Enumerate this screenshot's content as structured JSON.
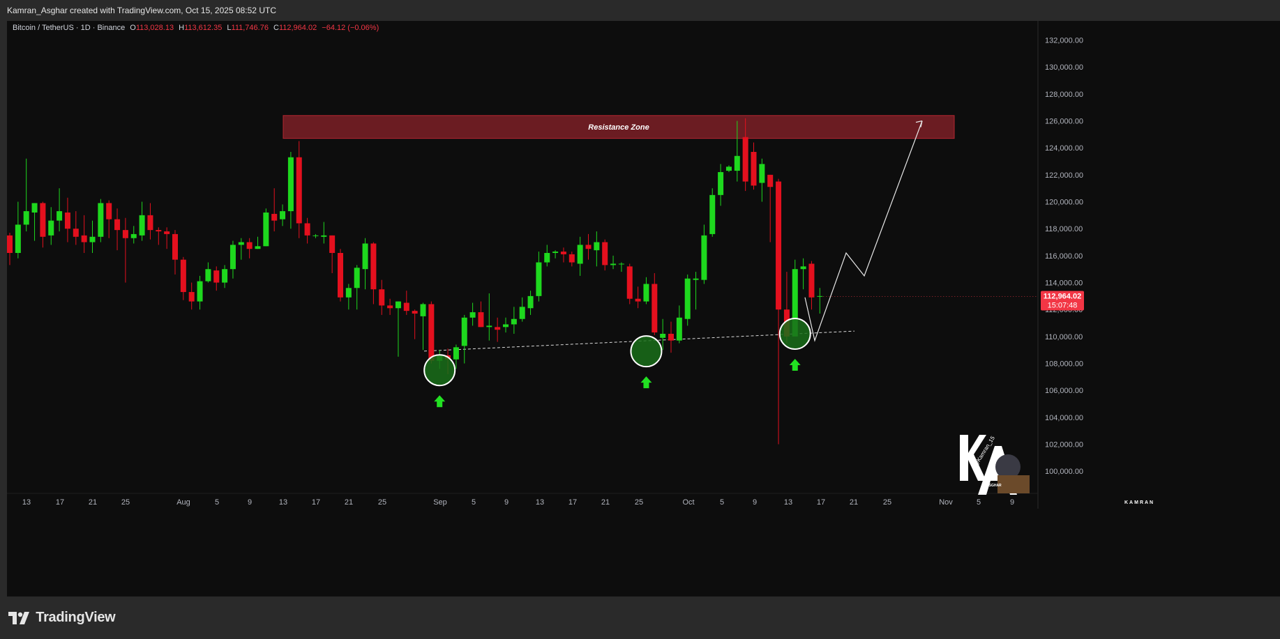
{
  "header": {
    "attribution": "Kamran_Asghar created with TradingView.com, Oct 15, 2025 08:52 UTC"
  },
  "legend": {
    "symbol": "Bitcoin / TetherUS · 1D · Binance",
    "open_label": "O",
    "open": "113,028.13",
    "high_label": "H",
    "high": "113,612.35",
    "low_label": "L",
    "low": "111,746.76",
    "close_label": "C",
    "close": "112,964.02",
    "change": "−64.12 (−0.06%)"
  },
  "price_tag": {
    "price": "112,964.02",
    "countdown": "15:07:48"
  },
  "annotations": {
    "resistance_label": "Resistance Zone"
  },
  "footer": {
    "brand": "TradingView"
  },
  "watermark": {
    "top_text": "KAMRAN",
    "handle": "@Kamran_15",
    "bottom_text": "ASGHAR"
  },
  "colors": {
    "up": "#1ed81e",
    "down": "#e4101e",
    "resistance": "#6b1c22",
    "zone_border": "#b32630"
  },
  "chart_data": {
    "type": "candlestick",
    "symbol": "BTCUSDT",
    "timeframe": "1D",
    "x_tick_labels": [
      "13",
      "17",
      "21",
      "25",
      "Aug",
      "5",
      "9",
      "13",
      "17",
      "21",
      "25",
      "Sep",
      "5",
      "9",
      "13",
      "17",
      "21",
      "25",
      "Oct",
      "5",
      "9",
      "13",
      "17",
      "21",
      "25",
      "Nov",
      "5",
      "9"
    ],
    "y_tick_labels": [
      "132,000.00",
      "130,000.00",
      "128,000.00",
      "126,000.00",
      "124,000.00",
      "122,000.00",
      "120,000.00",
      "118,000.00",
      "116,000.00",
      "114,000.00",
      "112,000.00",
      "110,000.00",
      "108,000.00",
      "106,000.00",
      "104,000.00",
      "102,000.00",
      "100,000.00"
    ],
    "ylim": [
      98500,
      133500
    ],
    "start_date": "2025-07-11",
    "candles": [
      [
        117500,
        116200,
        117700,
        115300
      ],
      [
        116200,
        118300,
        120000,
        115800
      ],
      [
        118300,
        119300,
        123200,
        117800
      ],
      [
        119200,
        119900,
        119900,
        117100
      ],
      [
        119900,
        117400,
        120000,
        116600
      ],
      [
        117500,
        118600,
        119600,
        116800
      ],
      [
        118600,
        119300,
        121000,
        117800
      ],
      [
        119200,
        118000,
        120300,
        117000
      ],
      [
        118000,
        117400,
        119300,
        116800
      ],
      [
        117500,
        117000,
        119000,
        116200
      ],
      [
        117000,
        117400,
        118600,
        116200
      ],
      [
        117400,
        119900,
        120200,
        117000
      ],
      [
        119900,
        118700,
        120100,
        117300
      ],
      [
        118700,
        117900,
        119500,
        116400
      ],
      [
        117900,
        117300,
        118800,
        114000
      ],
      [
        117300,
        117600,
        118200,
        116900
      ],
      [
        117500,
        119000,
        120000,
        117100
      ],
      [
        119000,
        117900,
        119900,
        117200
      ],
      [
        117900,
        117800,
        118100,
        116800
      ],
      [
        117800,
        117600,
        118100,
        116500
      ],
      [
        117600,
        115700,
        117900,
        114600
      ],
      [
        115700,
        113300,
        115900,
        112700
      ],
      [
        113300,
        112600,
        114000,
        112000
      ],
      [
        112600,
        114100,
        114500,
        112000
      ],
      [
        114100,
        115000,
        115500,
        114000
      ],
      [
        114900,
        114000,
        115200,
        113400
      ],
      [
        114000,
        115000,
        115300,
        113600
      ],
      [
        115000,
        116800,
        117100,
        114300
      ],
      [
        116800,
        117000,
        117300,
        115700
      ],
      [
        117000,
        116500,
        117300,
        115800
      ],
      [
        116500,
        116700,
        117400,
        116500
      ],
      [
        116700,
        119200,
        119500,
        116700
      ],
      [
        119100,
        118600,
        121000,
        117800
      ],
      [
        118700,
        119300,
        119800,
        118200
      ],
      [
        119300,
        123300,
        123700,
        118000
      ],
      [
        123300,
        118400,
        124500,
        117300
      ],
      [
        118400,
        117500,
        118800,
        116900
      ],
      [
        117500,
        117500,
        117600,
        117300
      ],
      [
        117400,
        117500,
        118500,
        116900
      ],
      [
        117500,
        116200,
        117500,
        114700
      ],
      [
        116200,
        112900,
        116500,
        112600
      ],
      [
        112900,
        113600,
        113900,
        112000
      ],
      [
        113600,
        115100,
        115300,
        112000
      ],
      [
        115000,
        116900,
        117300,
        113500
      ],
      [
        116900,
        113500,
        117000,
        112400
      ],
      [
        113500,
        112300,
        114200,
        111600
      ],
      [
        112300,
        112100,
        112800,
        111600
      ],
      [
        112100,
        112600,
        112600,
        108500
      ],
      [
        112500,
        111900,
        113400,
        111600
      ],
      [
        111900,
        111700,
        112000,
        109800
      ],
      [
        111500,
        112400,
        112500,
        109000
      ],
      [
        112400,
        108200,
        112600,
        108000
      ],
      [
        108200,
        108600,
        109000,
        107600
      ],
      [
        108600,
        108300,
        109100,
        107200
      ],
      [
        108300,
        109200,
        109400,
        107600
      ],
      [
        109300,
        111400,
        111600,
        108000
      ],
      [
        111400,
        111800,
        112500,
        110800
      ],
      [
        111800,
        110700,
        112600,
        110700
      ],
      [
        110700,
        110800,
        113200,
        109700
      ],
      [
        110700,
        110500,
        111400,
        109600
      ],
      [
        110700,
        110900,
        111400,
        110300
      ],
      [
        110900,
        111300,
        112200,
        110200
      ],
      [
        111300,
        112200,
        112900,
        111100
      ],
      [
        112100,
        113000,
        113400,
        111600
      ],
      [
        113000,
        115500,
        116300,
        112600
      ],
      [
        115500,
        116200,
        116800,
        115200
      ],
      [
        116200,
        116300,
        116400,
        115800
      ],
      [
        116300,
        116100,
        116600,
        115500
      ],
      [
        116100,
        115500,
        116300,
        115200
      ],
      [
        115400,
        116800,
        117400,
        114500
      ],
      [
        116800,
        116500,
        117600,
        115700
      ],
      [
        116400,
        117000,
        117800,
        115200
      ],
      [
        117000,
        115300,
        117200,
        114900
      ],
      [
        115300,
        115400,
        116000,
        115000
      ],
      [
        115400,
        115400,
        115500,
        114800
      ],
      [
        115200,
        112800,
        115400,
        112400
      ],
      [
        112800,
        112600,
        113700,
        112100
      ],
      [
        112600,
        113900,
        114400,
        112400
      ],
      [
        113900,
        110300,
        114700,
        110100
      ],
      [
        109900,
        110200,
        111300,
        109000
      ],
      [
        110200,
        109700,
        111100,
        108800
      ],
      [
        109700,
        111400,
        112300,
        109500
      ],
      [
        111300,
        114300,
        114600,
        110800
      ],
      [
        114200,
        114300,
        114800,
        112000
      ],
      [
        114200,
        117500,
        118300,
        113900
      ],
      [
        117600,
        120500,
        121000,
        117400
      ],
      [
        120500,
        122200,
        122800,
        119700
      ],
      [
        122300,
        122600,
        122700,
        122200
      ],
      [
        122300,
        123400,
        126000,
        121500
      ],
      [
        124800,
        121500,
        126200,
        120800
      ],
      [
        123700,
        121200,
        124400,
        120900
      ],
      [
        121400,
        122800,
        123200,
        120000
      ],
      [
        122000,
        121100,
        122000,
        117000
      ],
      [
        121500,
        112000,
        121700,
        102000
      ],
      [
        112000,
        110000,
        114800,
        109500
      ],
      [
        110000,
        115000,
        115700,
        110100
      ],
      [
        115000,
        115200,
        115800,
        113500
      ],
      [
        115400,
        112900,
        115600,
        112000
      ],
      [
        113000,
        113000,
        113600,
        111700
      ]
    ],
    "resistance_zone": {
      "low": 124700,
      "high": 126400,
      "label": "Resistance Zone"
    },
    "support_line": {
      "from": [
        108500
      ],
      "to": [
        110400
      ]
    },
    "support_touch_points": [
      {
        "price": 107500,
        "date": "2025-09-01"
      },
      {
        "price": 108900,
        "date": "2025-09-26"
      },
      {
        "price": 110200,
        "date": "2025-10-14"
      }
    ],
    "projection_path": [
      112900,
      109700,
      116200,
      114500,
      126000
    ],
    "last_price": 112964.02
  }
}
